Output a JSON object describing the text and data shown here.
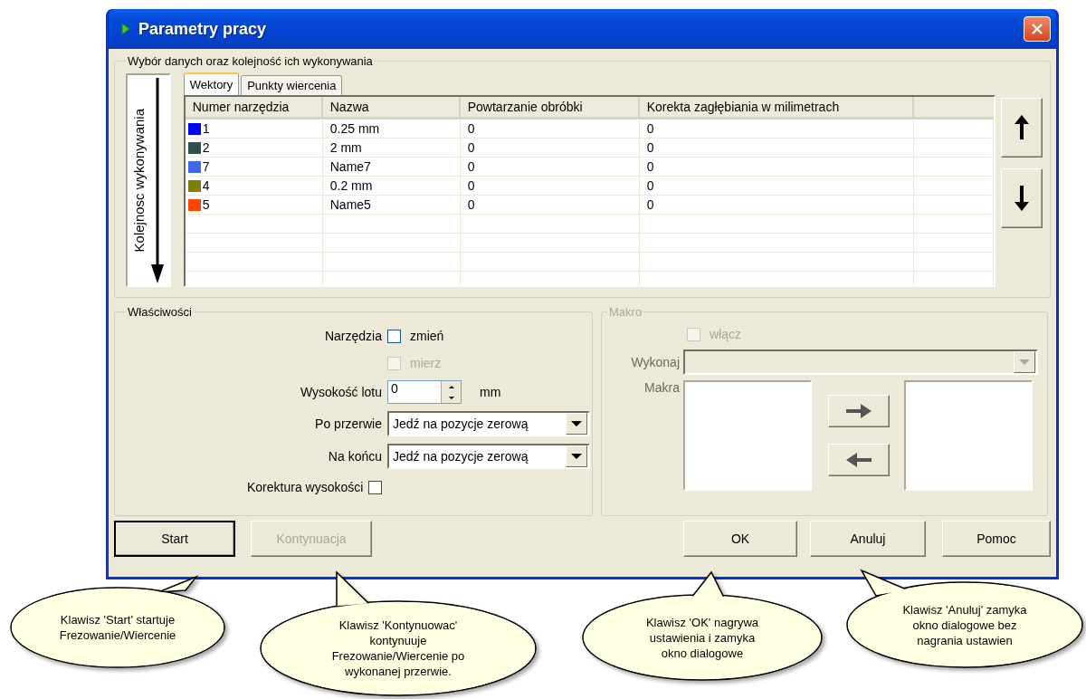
{
  "window": {
    "title": "Parametry pracy"
  },
  "selection": {
    "title": "Wybór danych oraz kolejność ich wykonywania",
    "order_label": "Kolejnosc wykonywania",
    "tabs": [
      {
        "label": "Wektory",
        "selected": true
      },
      {
        "label": "Punkty wiercenia",
        "selected": false
      }
    ],
    "columns": [
      "Numer narzędzia",
      "Nazwa",
      "Powtarzanie obróbki",
      "Korekta zagłębiania w milimetrach"
    ],
    "rows": [
      {
        "color": "#0000ff",
        "tool": "1",
        "name": "0.25 mm",
        "repeat": "0",
        "correction": "0"
      },
      {
        "color": "#2f4f4f",
        "tool": "2",
        "name": "2 mm",
        "repeat": "0",
        "correction": "0"
      },
      {
        "color": "#4169e1",
        "tool": "7",
        "name": "Name7",
        "repeat": "0",
        "correction": "0"
      },
      {
        "color": "#808000",
        "tool": "4",
        "name": "0.2 mm",
        "repeat": "0",
        "correction": "0"
      },
      {
        "color": "#ff4500",
        "tool": "5",
        "name": "Name5",
        "repeat": "0",
        "correction": "0"
      }
    ]
  },
  "properties": {
    "title": "Właściwości",
    "tools_label": "Narzędzia",
    "change": {
      "label": "zmień",
      "checked": false,
      "disabled": false
    },
    "measure": {
      "label": "mierz",
      "checked": false,
      "disabled": true
    },
    "height": {
      "label": "Wysokość lotu",
      "value": "0",
      "unit": "mm"
    },
    "after_break": {
      "label": "Po przerwie",
      "value": "Jedź na pozycje zerową"
    },
    "at_end": {
      "label": "Na końcu",
      "value": "Jedź na pozycje zerową"
    },
    "height_correction": {
      "label": "Korektura wysokości",
      "checked": false
    }
  },
  "macro": {
    "title": "Makro",
    "disabled": true,
    "enable": {
      "label": "włącz",
      "checked": false
    },
    "execute_label": "Wykonaj",
    "macros_label": "Makra"
  },
  "buttons": [
    {
      "label": "Start",
      "disabled": false,
      "default": true
    },
    {
      "label": "Kontynuacja",
      "disabled": true,
      "default": false
    },
    {
      "label": "OK",
      "disabled": false,
      "default": false
    },
    {
      "label": "Anuluj",
      "disabled": false,
      "default": false
    },
    {
      "label": "Pomoc",
      "disabled": false,
      "default": false
    }
  ],
  "callouts": [
    {
      "text": "Klawisz 'Start' startuje\nFrezowanie/Wiercenie"
    },
    {
      "text": "Klawisz 'Kontynuowac'\nkontynuuje\nFrezowanie/Wiercenie po\nwykonanej przerwie."
    },
    {
      "text": "Klawisz 'OK' nagrywa\nustawienia i zamyka\nokno dialogowe"
    },
    {
      "text": "Klawisz 'Anuluj' zamyka\nokno dialogowe bez\nnagrania ustawien"
    }
  ]
}
